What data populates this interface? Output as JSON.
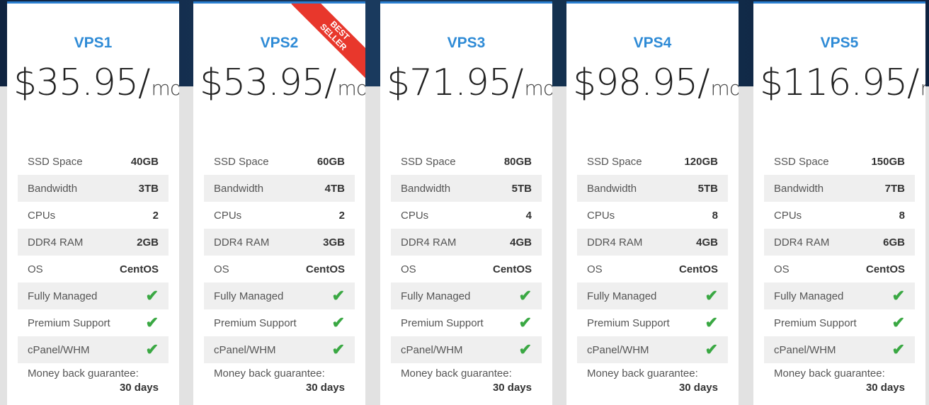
{
  "features": [
    "SSD Space",
    "Bandwidth",
    "CPUs",
    "DDR4 RAM",
    "OS",
    "Fully Managed",
    "Premium Support",
    "cPanel/WHM"
  ],
  "money_back_label": "Money back guarantee:",
  "ribbon": {
    "line1": "BEST",
    "line2": "SELLER"
  },
  "unit": "mo",
  "plans": [
    {
      "name": "VPS1",
      "price": "$35.95/",
      "values": [
        "40GB",
        "3TB",
        "2",
        "2GB",
        "CentOS",
        "check",
        "check",
        "check"
      ],
      "money_back": "30 days"
    },
    {
      "name": "VPS2",
      "price": "$53.95/",
      "values": [
        "60GB",
        "4TB",
        "2",
        "3GB",
        "CentOS",
        "check",
        "check",
        "check"
      ],
      "money_back": "30 days",
      "best_seller": true
    },
    {
      "name": "VPS3",
      "price": "$71.95/",
      "values": [
        "80GB",
        "5TB",
        "4",
        "4GB",
        "CentOS",
        "check",
        "check",
        "check"
      ],
      "money_back": "30 days"
    },
    {
      "name": "VPS4",
      "price": "$98.95/",
      "values": [
        "120GB",
        "5TB",
        "8",
        "4GB",
        "CentOS",
        "check",
        "check",
        "check"
      ],
      "money_back": "30 days"
    },
    {
      "name": "VPS5",
      "price": "$116.95/",
      "values": [
        "150GB",
        "7TB",
        "8",
        "6GB",
        "CentOS",
        "check",
        "check",
        "check"
      ],
      "money_back": "30 days"
    }
  ],
  "colors": {
    "accent": "#2f8bd6",
    "check": "#3aa843",
    "ribbon": "#e8372c"
  }
}
